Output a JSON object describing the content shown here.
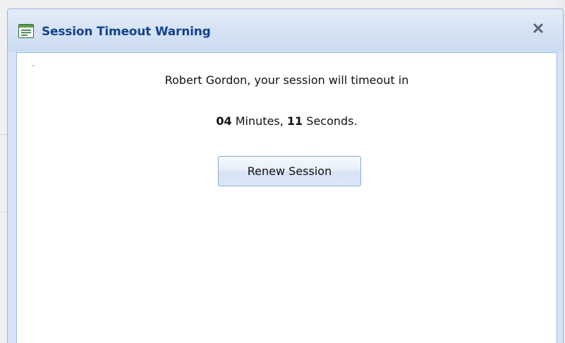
{
  "dialog": {
    "title": "Session Timeout Warning",
    "title_icon": "window-icon",
    "close_label": "x",
    "message": "Robert Gordon, your session will timeout in",
    "countdown": {
      "minutes": "04",
      "minutes_label": "Minutes,",
      "seconds": "11",
      "seconds_label": "Seconds."
    },
    "renew_button_label": "Renew Session"
  },
  "colors": {
    "title_text": "#15428b",
    "titlebar": "#d5e2f4",
    "border": "#99bbe8",
    "content_bg": "#ffffff"
  }
}
